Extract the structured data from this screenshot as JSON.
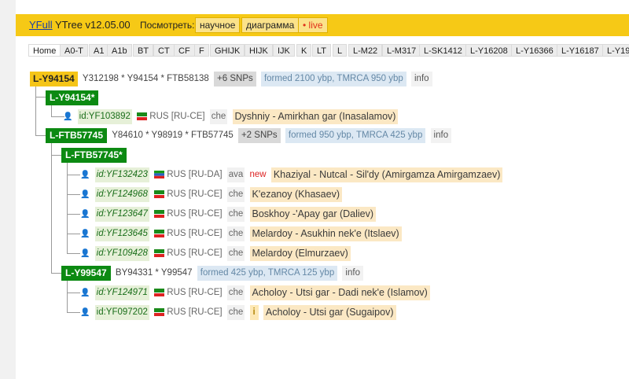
{
  "header": {
    "brand_link": "YFull",
    "brand_text": "YTree v12.05.00",
    "view_label": "Посмотреть:",
    "buttons": {
      "scientific": "научное",
      "diagram": "диаграмма",
      "live": "• live"
    }
  },
  "tabs": [
    "Home",
    "A0-T",
    "A1",
    "A1b",
    "BT",
    "CT",
    "CF",
    "F",
    "GHIJK",
    "HIJK",
    "IJK",
    "K",
    "LT",
    "L",
    "L-M22",
    "L-M317",
    "L-SK1412",
    "L-Y16208",
    "L-Y16366",
    "L-Y16187",
    "L-Y19"
  ],
  "tree": {
    "root": {
      "label": "L-Y94154",
      "snps": "Y312198 * Y94154 * FTB58138",
      "count": "+6 SNPs",
      "formed": "formed 2100 ybp, TMRCA 950 ybp",
      "info": "info"
    },
    "sub1": {
      "label": "L-Y94154*"
    },
    "p1": {
      "id": "id:YF103892",
      "country": "RUS [RU-CE]",
      "lang": "che",
      "name": "Dyshniy - Amirkhan gar (Inasalamov)"
    },
    "ftb": {
      "label": "L-FTB57745",
      "snps": "Y84610 * Y98919 * FTB57745",
      "count": "+2 SNPs",
      "formed": "formed 950 ybp, TMRCA 425 ybp",
      "info": "info"
    },
    "ftbstar": {
      "label": "L-FTB57745*"
    },
    "p2": {
      "id": "id:YF132423",
      "country": "RUS [RU-DA]",
      "lang": "ava",
      "new": "new",
      "name": "Khaziyal - Nutcal - Sil'dy (Amirgamza Amirgamzaev)"
    },
    "p3": {
      "id": "id:YF124968",
      "country": "RUS [RU-CE]",
      "lang": "che",
      "name": "K'ezanoy (Khasaev)"
    },
    "p4": {
      "id": "id:YF123647",
      "country": "RUS [RU-CE]",
      "lang": "che",
      "name": "Boskhoy -'Apay gar (Daliev)"
    },
    "p5": {
      "id": "id:YF123645",
      "country": "RUS [RU-CE]",
      "lang": "che",
      "name": "Melardoy - Asukhin nek'e (Itslaev)"
    },
    "p6": {
      "id": "id:YF109428",
      "country": "RUS [RU-CE]",
      "lang": "che",
      "name": "Melardoy (Elmurzaev)"
    },
    "y99": {
      "label": "L-Y99547",
      "snps": "BY94331 * Y99547",
      "formed": "formed 425 ybp, TMRCA 125 ybp",
      "info": "info"
    },
    "p7": {
      "id": "id:YF124971",
      "country": "RUS [RU-CE]",
      "lang": "che",
      "name": "Acholoy - Utsi gar - Dadi nek'e (Islamov)"
    },
    "p8": {
      "id": "id:YF097202",
      "country": "RUS [RU-CE]",
      "lang": "che",
      "info_icon": "i",
      "name": "Acholoy - Utsi gar (Sugaipov)"
    }
  },
  "colors": {
    "header": "#f6c916",
    "haplogroup": "#0c8a12",
    "root": "#f5c518"
  }
}
